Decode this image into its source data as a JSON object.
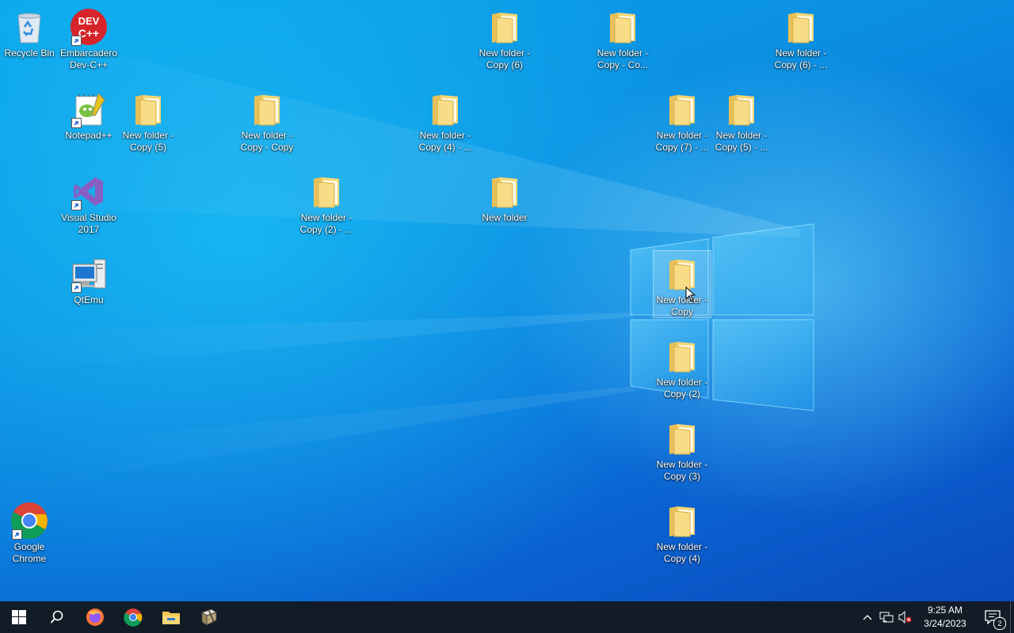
{
  "desktop": {
    "icons": {
      "recycle_bin": "Recycle Bin",
      "devcpp": "Embarcadero Dev-C++",
      "notepadpp": "Notepad++",
      "visual_studio": "Visual Studio 2017",
      "qtemu": "QtEmu",
      "chrome": "Google Chrome",
      "folder_copy6": "New folder - Copy (6)",
      "folder_copy_co": "New folder - Copy - Co...",
      "folder_copy6_more": "New folder - Copy (6) - ...",
      "folder_copy5": "New folder - Copy (5)",
      "folder_copy_copy": "New folder - Copy - Copy",
      "folder_copy4_more": "New folder - Copy (4) - ...",
      "folder_copy7_more": "New folder - Copy (7) - ...",
      "folder_copy5_more": "New folder - Copy (5) - ...",
      "folder_copy2_more": "New folder - Copy (2) - ...",
      "folder_new": "New folder",
      "folder_copy": "New folder - Copy",
      "folder_copy2": "New folder - Copy (2)",
      "folder_copy3": "New folder - Copy (3)",
      "folder_copy4": "New folder - Copy (4)"
    },
    "selected_icon": "New folder - Copy"
  },
  "taskbar": {
    "pinned": [
      "start-icon",
      "search-icon",
      "firefox-icon",
      "chrome-icon",
      "file-explorer-icon",
      "app-icon"
    ],
    "clock": {
      "time": "9:25 AM",
      "date": "3/24/2023"
    },
    "notification_count": "2"
  },
  "colors": {
    "taskbar": "#121c27",
    "folder": "#f6d775"
  }
}
